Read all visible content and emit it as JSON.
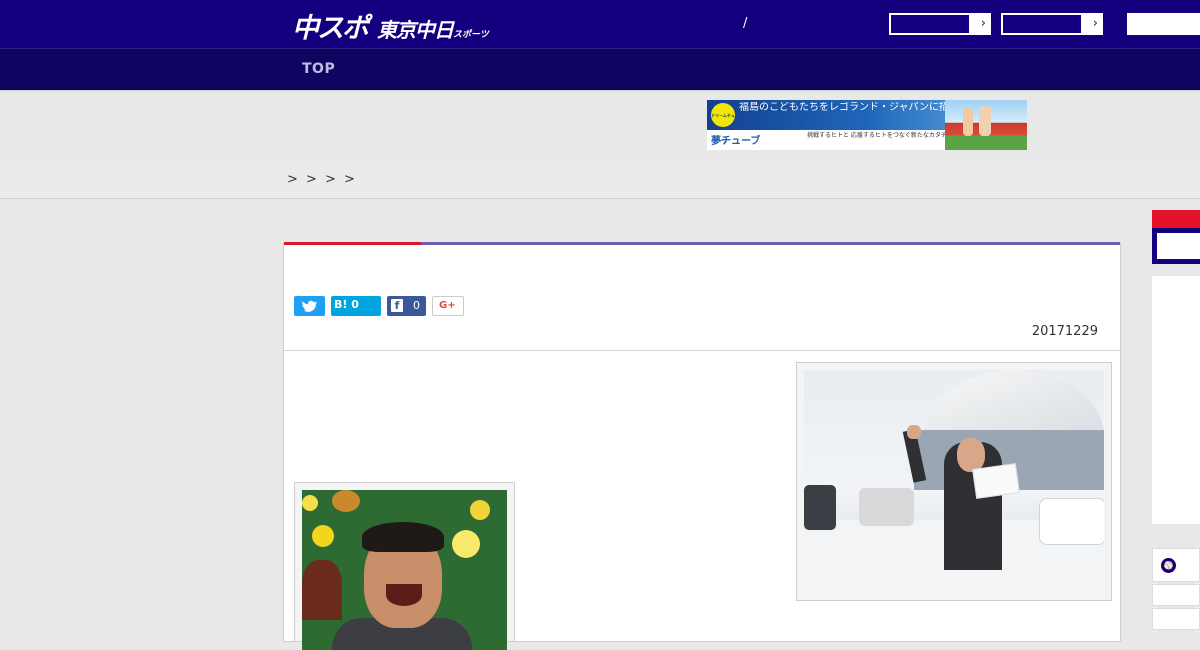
{
  "header": {
    "logo_main": "中スポ",
    "logo_sub": "東京中日",
    "logo_tiny": "スポーツ",
    "slash": "/",
    "box_arrow": "›"
  },
  "nav": {
    "top_label": "TOP"
  },
  "ad": {
    "badge": "ドリームチューブ",
    "line1": "福島のこどもたちをレゴランド・ジャパンに招待したい── そんな夢を一緒に叶えませんか?",
    "line2": "夢チューブ",
    "line3": "挑戦するヒトと 応援するヒトをつなぐ新たなカタチ"
  },
  "breadcrumb": {
    "sep": ">"
  },
  "share": {
    "twitter_icon": "twitter-icon",
    "hatena_label": "B! 0",
    "facebook_count": "0",
    "facebook_glyph": "f",
    "gplus_label": "G+"
  },
  "article": {
    "date": "20171229"
  },
  "sidebar": {
    "ball_icon": "baseball-icon"
  },
  "colors": {
    "header": "#14007f",
    "nav": "#0f0460",
    "accent_red": "#d5182b",
    "accent_purple": "#6e5fb0"
  }
}
